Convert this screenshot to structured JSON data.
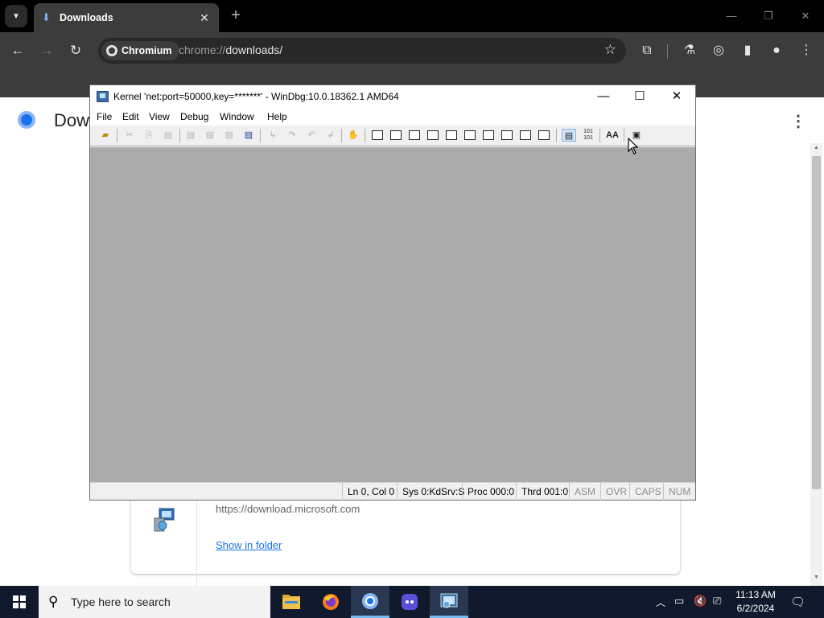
{
  "browser": {
    "tab_title": "Downloads",
    "tab_close": "✕",
    "new_tab": "+",
    "chip_label": "Chromium",
    "url_scheme": "chrome://",
    "url_path": "downloads/"
  },
  "page": {
    "title": "Dow",
    "download": {
      "source": "https://download.microsoft.com",
      "show_in_folder": "Show in folder"
    }
  },
  "windbg": {
    "title": "Kernel 'net:port=50000,key=*******' - WinDbg:10.0.18362.1 AMD64",
    "menu": [
      "File",
      "Edit",
      "View",
      "Debug",
      "Window",
      "Help"
    ],
    "toolbar_text": {
      "binary": "101\n101",
      "font": "AA"
    },
    "status": {
      "position": "Ln 0, Col 0",
      "sys": "Sys 0:KdSrv:S",
      "proc": "Proc 000:0",
      "thrd": "Thrd 001:0",
      "asm": "ASM",
      "ovr": "OVR",
      "caps": "CAPS",
      "num": "NUM"
    }
  },
  "taskbar": {
    "search_placeholder": "Type here to search",
    "time": "11:13 AM",
    "date": "6/2/2024"
  },
  "colors": {
    "taskbar_bg": "#101a2c",
    "windbg_workspace": "#ababab",
    "link": "#1a73e8",
    "chrome_dark": "#3c3c3c"
  }
}
